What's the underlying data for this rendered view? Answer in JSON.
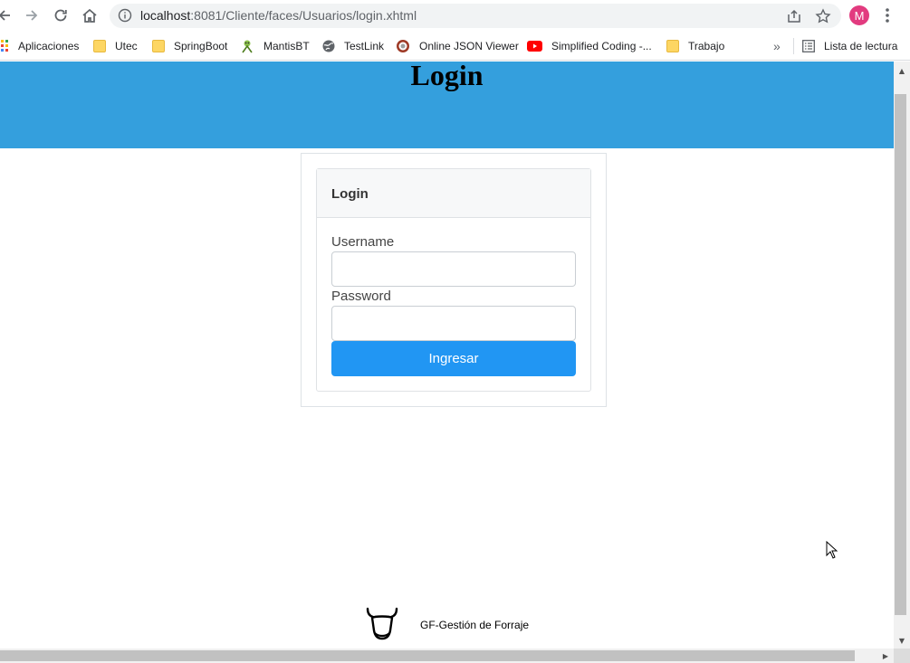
{
  "browser": {
    "url_host": "localhost",
    "url_rest": ":8081/Cliente/faces/Usuarios/login.xhtml",
    "avatar_letter": "M",
    "icons": {
      "back": "arrow-left-icon",
      "forward": "arrow-right-icon",
      "reload": "reload-icon",
      "home": "home-icon",
      "info": "info-icon",
      "share": "share-icon",
      "star": "star-icon",
      "menu": "kebab-menu-icon"
    }
  },
  "bookmarks": {
    "items": [
      {
        "label": "Aplicaciones",
        "icon": "apps-grid-icon"
      },
      {
        "label": "Utec",
        "icon": "folder-icon"
      },
      {
        "label": "SpringBoot",
        "icon": "folder-icon"
      },
      {
        "label": "MantisBT",
        "icon": "mantis-icon"
      },
      {
        "label": "TestLink",
        "icon": "globe-icon"
      },
      {
        "label": "Online JSON Viewer",
        "icon": "json-viewer-icon"
      },
      {
        "label": "Simplified Coding -...",
        "icon": "youtube-icon"
      },
      {
        "label": "Trabajo",
        "icon": "folder-icon"
      }
    ],
    "overflow": "»",
    "reading_list": "Lista de lectura"
  },
  "page": {
    "header_title": "Login",
    "header_color": "#349fdd",
    "card_title": "Login",
    "username_label": "Username",
    "username_value": "",
    "password_label": "Password",
    "password_value": "",
    "submit_label": "Ingresar",
    "button_color": "#2196f3",
    "footer_brand": "GF-Gestión de Forraje",
    "footer_icon": "cow-head-icon"
  }
}
